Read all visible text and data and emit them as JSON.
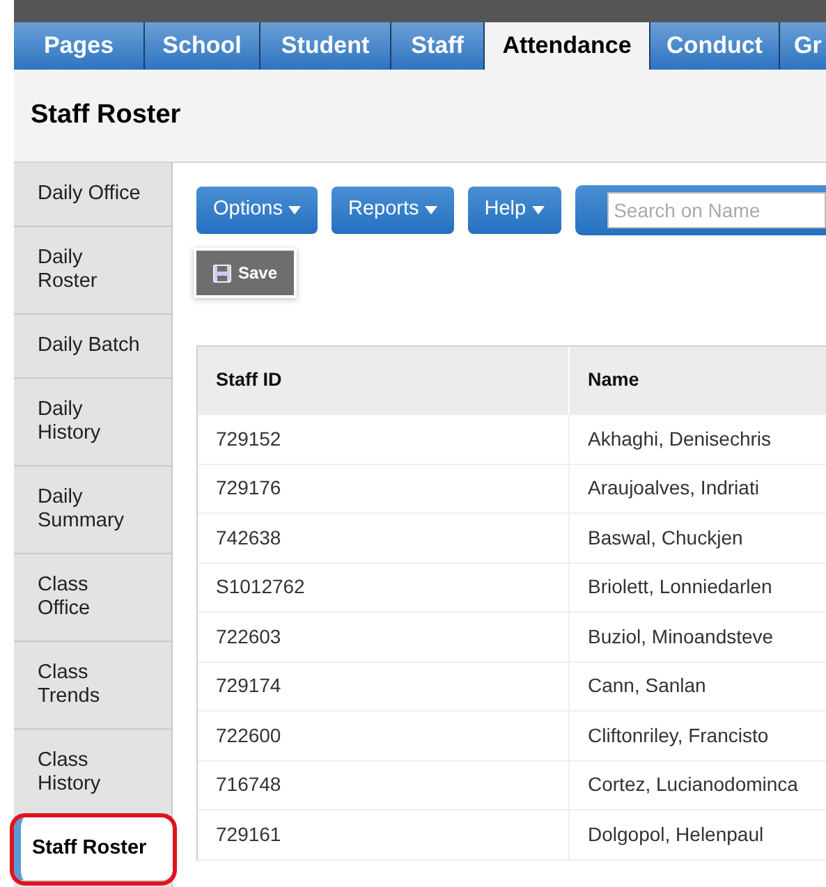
{
  "tabs": [
    {
      "label": "Pages",
      "selected": false
    },
    {
      "label": "School",
      "selected": false
    },
    {
      "label": "Student",
      "selected": false
    },
    {
      "label": "Staff",
      "selected": false
    },
    {
      "label": "Attendance",
      "selected": true
    },
    {
      "label": "Conduct",
      "selected": false
    },
    {
      "label": "Gr",
      "selected": false
    }
  ],
  "page_title": "Staff Roster",
  "sidebar": {
    "items": [
      {
        "label": "Daily Office",
        "selected": false,
        "highlighted": false
      },
      {
        "label": "Daily\nRoster",
        "selected": false,
        "highlighted": false
      },
      {
        "label": "Daily Batch",
        "selected": false,
        "highlighted": false
      },
      {
        "label": "Daily\nHistory",
        "selected": false,
        "highlighted": false
      },
      {
        "label": "Daily\nSummary",
        "selected": false,
        "highlighted": false
      },
      {
        "label": "Class\nOffice",
        "selected": false,
        "highlighted": false
      },
      {
        "label": "Class\nTrends",
        "selected": false,
        "highlighted": false
      },
      {
        "label": "Class\nHistory",
        "selected": false,
        "highlighted": false
      },
      {
        "label": "Staff Roster",
        "selected": true,
        "highlighted": true
      }
    ]
  },
  "toolbar": {
    "menus": [
      "Options",
      "Reports",
      "Help"
    ],
    "search": {
      "placeholder": "Search on Name"
    },
    "save_button": "Save"
  },
  "table": {
    "columns": [
      "Staff ID",
      "Name"
    ],
    "rows": [
      [
        "729152",
        "Akhaghi, Denisechris"
      ],
      [
        "729176",
        "Araujoalves, Indriati"
      ],
      [
        "742638",
        "Baswal, Chuckjen"
      ],
      [
        "S1012762",
        "Briolett, Lonniedarlen"
      ],
      [
        "722603",
        "Buziol, Minoandsteve"
      ],
      [
        "729174",
        "Cann, Sanlan"
      ],
      [
        "722600",
        "Cliftonriley, Francisto"
      ],
      [
        "716748",
        "Cortez, Lucianodominca"
      ],
      [
        "729161",
        "Dolgopol, Helenpaul"
      ]
    ]
  }
}
